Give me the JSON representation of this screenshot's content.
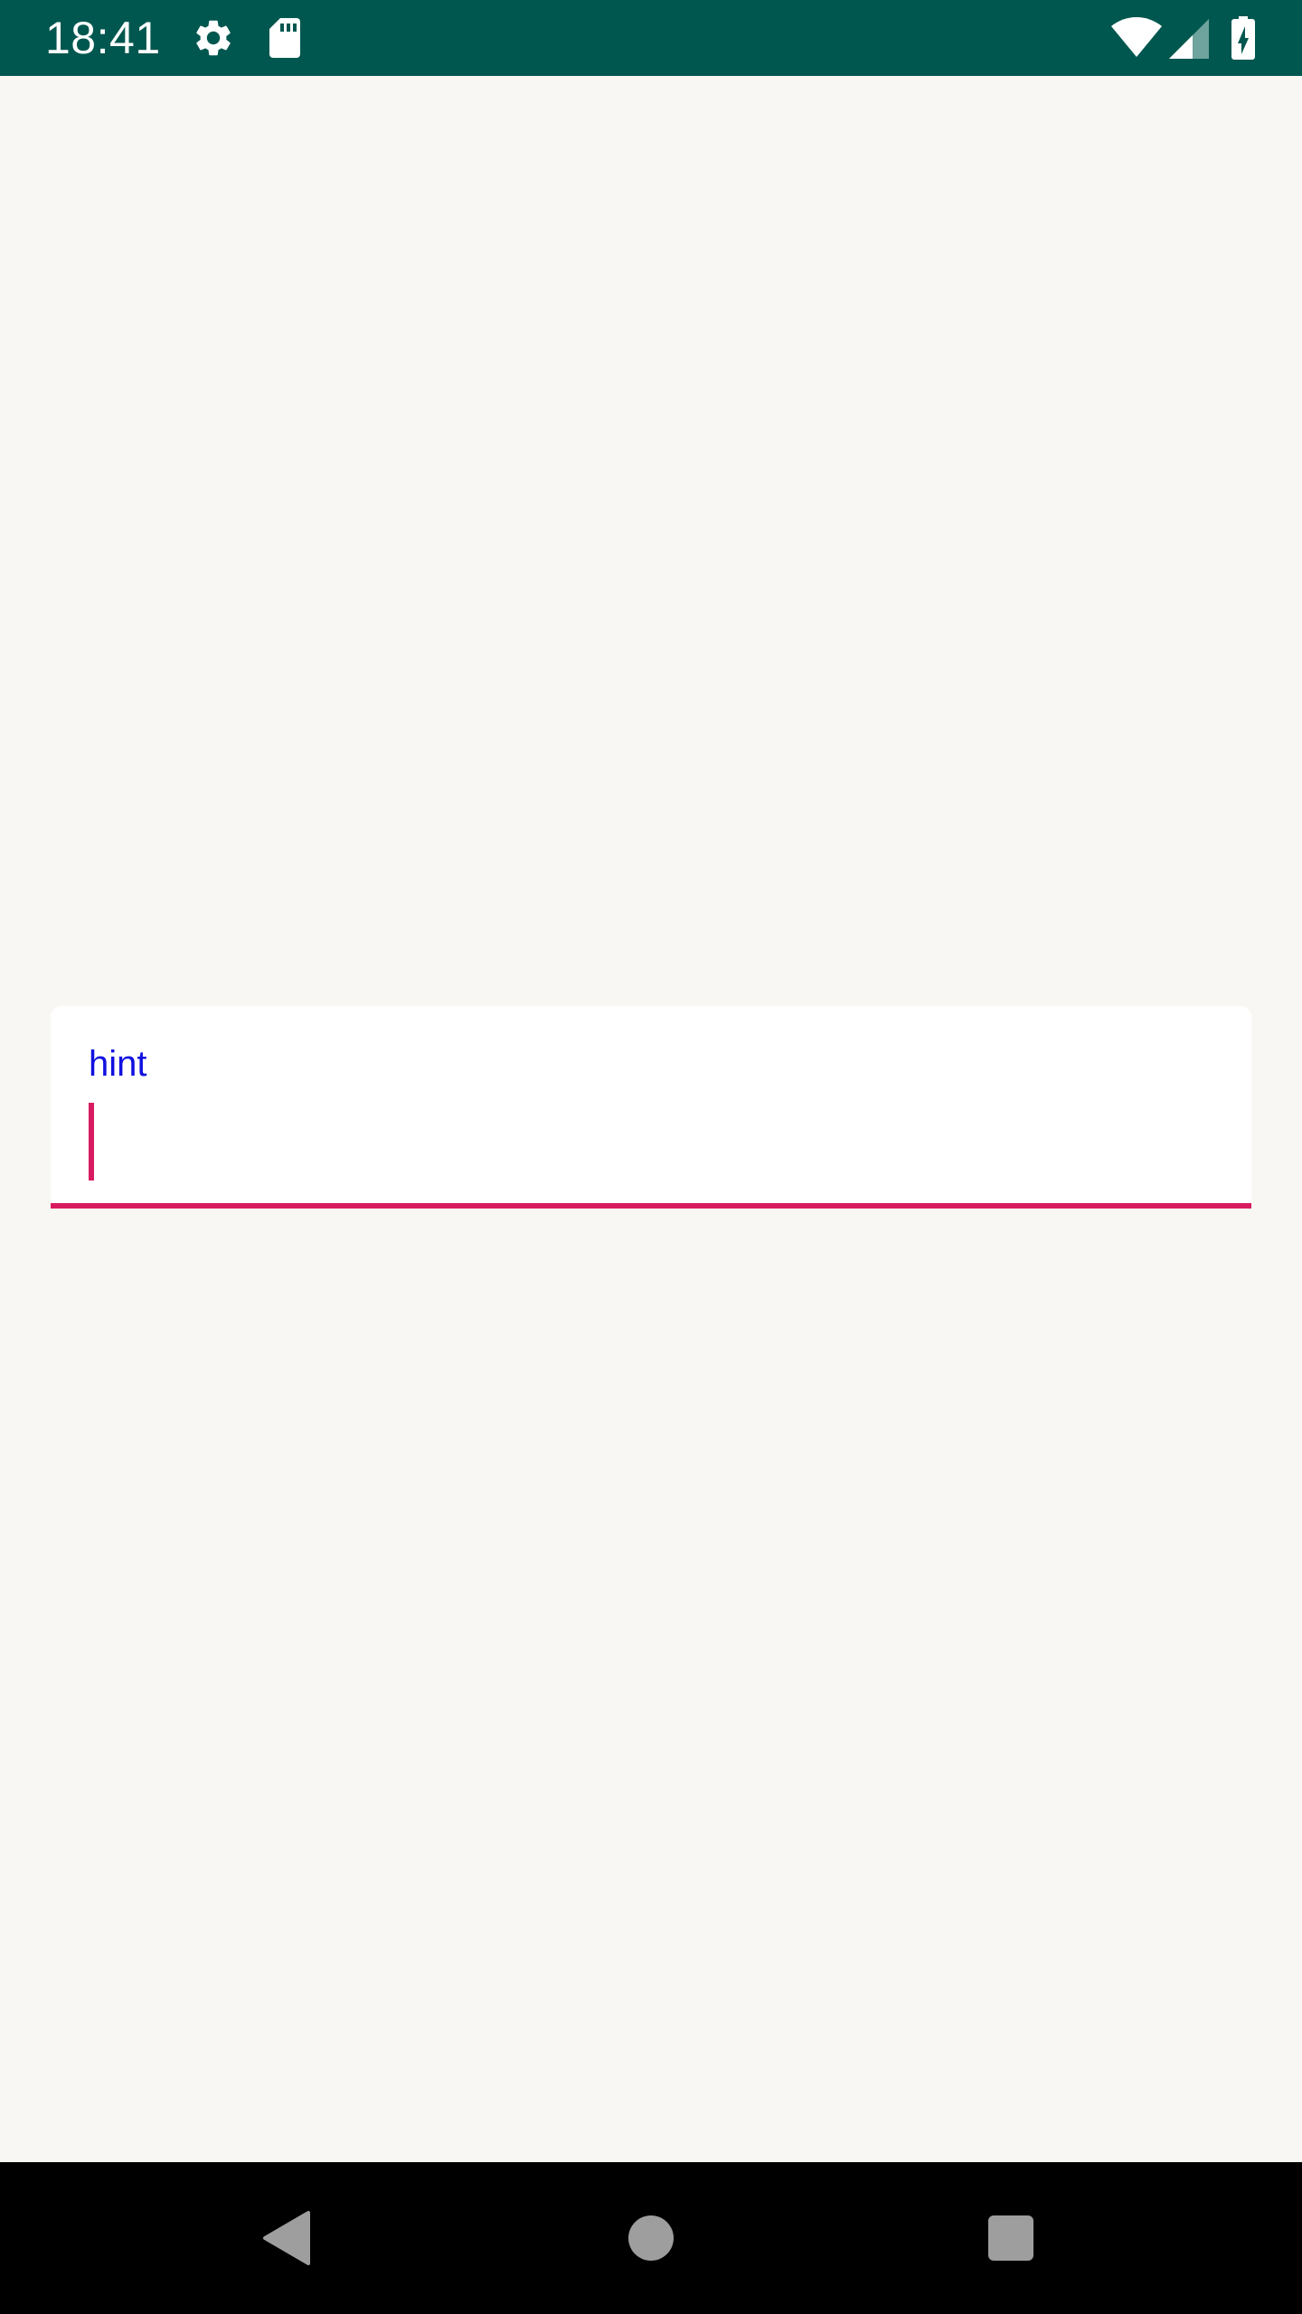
{
  "status_bar": {
    "time": "18:41",
    "background": "#00574f",
    "icons": [
      "settings-icon",
      "sd-card-icon",
      "wifi-icon",
      "cell-signal-icon",
      "battery-charging-icon"
    ]
  },
  "text_field": {
    "hint": "hint",
    "value": "",
    "accent_color": "#d81b60",
    "hint_color": "#1010e0"
  },
  "nav_bar": {
    "buttons": [
      "back-icon",
      "home-icon",
      "recents-icon"
    ],
    "icon_color": "#9e9e9e"
  }
}
